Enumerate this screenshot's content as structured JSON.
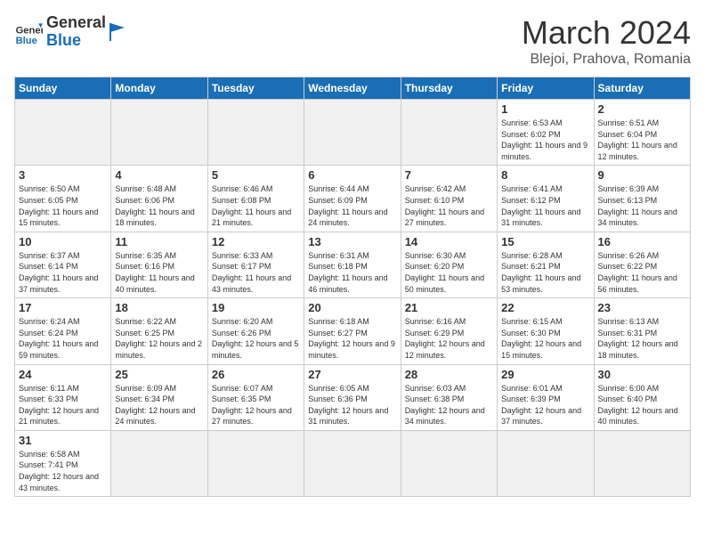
{
  "logo": {
    "text_general": "General",
    "text_blue": "Blue"
  },
  "header": {
    "month_year": "March 2024",
    "location": "Blejoi, Prahova, Romania"
  },
  "days_of_week": [
    "Sunday",
    "Monday",
    "Tuesday",
    "Wednesday",
    "Thursday",
    "Friday",
    "Saturday"
  ],
  "weeks": [
    [
      {
        "day": "",
        "empty": true
      },
      {
        "day": "",
        "empty": true
      },
      {
        "day": "",
        "empty": true
      },
      {
        "day": "",
        "empty": true
      },
      {
        "day": "",
        "empty": true
      },
      {
        "day": "1",
        "sunrise": "6:53 AM",
        "sunset": "6:02 PM",
        "daylight": "11 hours and 9 minutes."
      },
      {
        "day": "2",
        "sunrise": "6:51 AM",
        "sunset": "6:04 PM",
        "daylight": "11 hours and 12 minutes."
      }
    ],
    [
      {
        "day": "3",
        "sunrise": "6:50 AM",
        "sunset": "6:05 PM",
        "daylight": "11 hours and 15 minutes."
      },
      {
        "day": "4",
        "sunrise": "6:48 AM",
        "sunset": "6:06 PM",
        "daylight": "11 hours and 18 minutes."
      },
      {
        "day": "5",
        "sunrise": "6:46 AM",
        "sunset": "6:08 PM",
        "daylight": "11 hours and 21 minutes."
      },
      {
        "day": "6",
        "sunrise": "6:44 AM",
        "sunset": "6:09 PM",
        "daylight": "11 hours and 24 minutes."
      },
      {
        "day": "7",
        "sunrise": "6:42 AM",
        "sunset": "6:10 PM",
        "daylight": "11 hours and 27 minutes."
      },
      {
        "day": "8",
        "sunrise": "6:41 AM",
        "sunset": "6:12 PM",
        "daylight": "11 hours and 31 minutes."
      },
      {
        "day": "9",
        "sunrise": "6:39 AM",
        "sunset": "6:13 PM",
        "daylight": "11 hours and 34 minutes."
      }
    ],
    [
      {
        "day": "10",
        "sunrise": "6:37 AM",
        "sunset": "6:14 PM",
        "daylight": "11 hours and 37 minutes."
      },
      {
        "day": "11",
        "sunrise": "6:35 AM",
        "sunset": "6:16 PM",
        "daylight": "11 hours and 40 minutes."
      },
      {
        "day": "12",
        "sunrise": "6:33 AM",
        "sunset": "6:17 PM",
        "daylight": "11 hours and 43 minutes."
      },
      {
        "day": "13",
        "sunrise": "6:31 AM",
        "sunset": "6:18 PM",
        "daylight": "11 hours and 46 minutes."
      },
      {
        "day": "14",
        "sunrise": "6:30 AM",
        "sunset": "6:20 PM",
        "daylight": "11 hours and 50 minutes."
      },
      {
        "day": "15",
        "sunrise": "6:28 AM",
        "sunset": "6:21 PM",
        "daylight": "11 hours and 53 minutes."
      },
      {
        "day": "16",
        "sunrise": "6:26 AM",
        "sunset": "6:22 PM",
        "daylight": "11 hours and 56 minutes."
      }
    ],
    [
      {
        "day": "17",
        "sunrise": "6:24 AM",
        "sunset": "6:24 PM",
        "daylight": "11 hours and 59 minutes."
      },
      {
        "day": "18",
        "sunrise": "6:22 AM",
        "sunset": "6:25 PM",
        "daylight": "12 hours and 2 minutes."
      },
      {
        "day": "19",
        "sunrise": "6:20 AM",
        "sunset": "6:26 PM",
        "daylight": "12 hours and 5 minutes."
      },
      {
        "day": "20",
        "sunrise": "6:18 AM",
        "sunset": "6:27 PM",
        "daylight": "12 hours and 9 minutes."
      },
      {
        "day": "21",
        "sunrise": "6:16 AM",
        "sunset": "6:29 PM",
        "daylight": "12 hours and 12 minutes."
      },
      {
        "day": "22",
        "sunrise": "6:15 AM",
        "sunset": "6:30 PM",
        "daylight": "12 hours and 15 minutes."
      },
      {
        "day": "23",
        "sunrise": "6:13 AM",
        "sunset": "6:31 PM",
        "daylight": "12 hours and 18 minutes."
      }
    ],
    [
      {
        "day": "24",
        "sunrise": "6:11 AM",
        "sunset": "6:33 PM",
        "daylight": "12 hours and 21 minutes."
      },
      {
        "day": "25",
        "sunrise": "6:09 AM",
        "sunset": "6:34 PM",
        "daylight": "12 hours and 24 minutes."
      },
      {
        "day": "26",
        "sunrise": "6:07 AM",
        "sunset": "6:35 PM",
        "daylight": "12 hours and 27 minutes."
      },
      {
        "day": "27",
        "sunrise": "6:05 AM",
        "sunset": "6:36 PM",
        "daylight": "12 hours and 31 minutes."
      },
      {
        "day": "28",
        "sunrise": "6:03 AM",
        "sunset": "6:38 PM",
        "daylight": "12 hours and 34 minutes."
      },
      {
        "day": "29",
        "sunrise": "6:01 AM",
        "sunset": "6:39 PM",
        "daylight": "12 hours and 37 minutes."
      },
      {
        "day": "30",
        "sunrise": "6:00 AM",
        "sunset": "6:40 PM",
        "daylight": "12 hours and 40 minutes."
      }
    ],
    [
      {
        "day": "31",
        "sunrise": "6:58 AM",
        "sunset": "7:41 PM",
        "daylight": "12 hours and 43 minutes."
      },
      {
        "day": "",
        "empty": true
      },
      {
        "day": "",
        "empty": true
      },
      {
        "day": "",
        "empty": true
      },
      {
        "day": "",
        "empty": true
      },
      {
        "day": "",
        "empty": true
      },
      {
        "day": "",
        "empty": true
      }
    ]
  ]
}
